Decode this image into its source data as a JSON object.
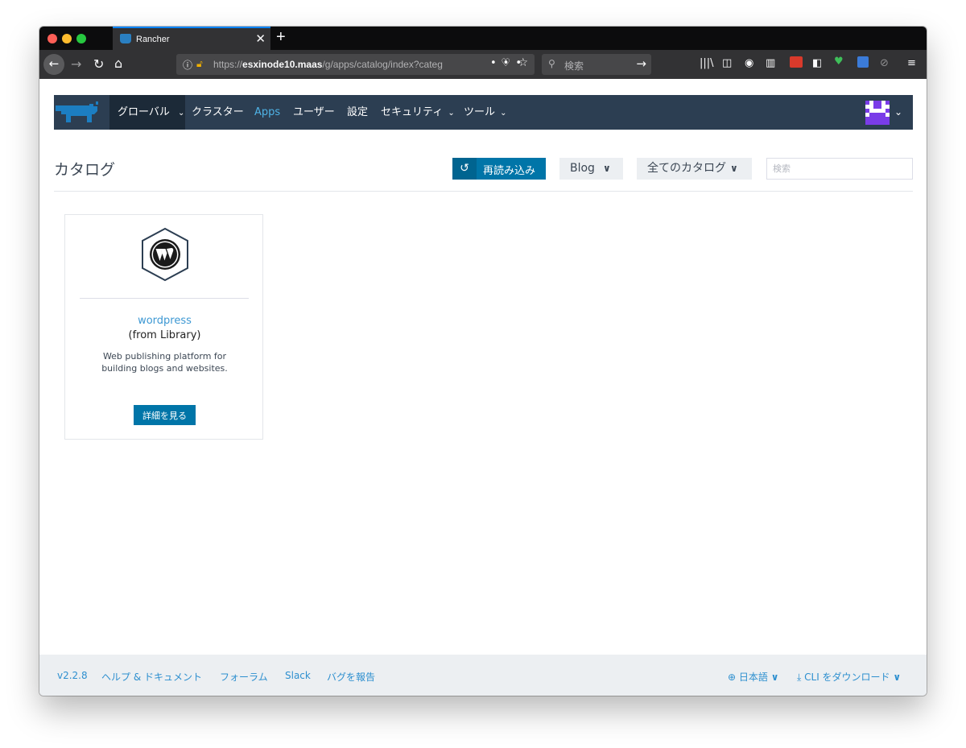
{
  "browser": {
    "tab_title": "Rancher",
    "tab_close": "✕",
    "new_tab": "+",
    "url_prefix": "https://",
    "url_host": "esxinode10.maas",
    "url_path": "/g/apps/catalog/index?categ",
    "search_placeholder": "検索",
    "url_more": "•••"
  },
  "nav": {
    "global": "グローバル",
    "items": [
      {
        "label": "クラスター"
      },
      {
        "label": "Apps",
        "active": true
      },
      {
        "label": "ユーザー"
      },
      {
        "label": "設定"
      },
      {
        "label": "セキュリティ"
      },
      {
        "label": "ツール"
      }
    ]
  },
  "page": {
    "title": "カタログ",
    "refresh_label": "再読み込み",
    "catalog_filter": "Blog",
    "catalog_select": "全てのカタログ",
    "search_placeholder": "検索"
  },
  "catalog_items": [
    {
      "name": "wordpress",
      "source": "(from Library)",
      "description": "Web publishing platform for building blogs and websites.",
      "button_label": "詳細を見る"
    }
  ],
  "footer": {
    "version": "v2.2.8",
    "help": "ヘルプ & ドキュメント",
    "forum": "フォーラム",
    "slack": "Slack",
    "report_bug": "バグを報告",
    "language": "日本語",
    "cli_download": "CLI をダウンロード"
  },
  "colors": {
    "accent": "#0075a8",
    "header_bg": "#2c3e52",
    "link": "#2d8fcf",
    "avatar": "#7a3ce8"
  }
}
